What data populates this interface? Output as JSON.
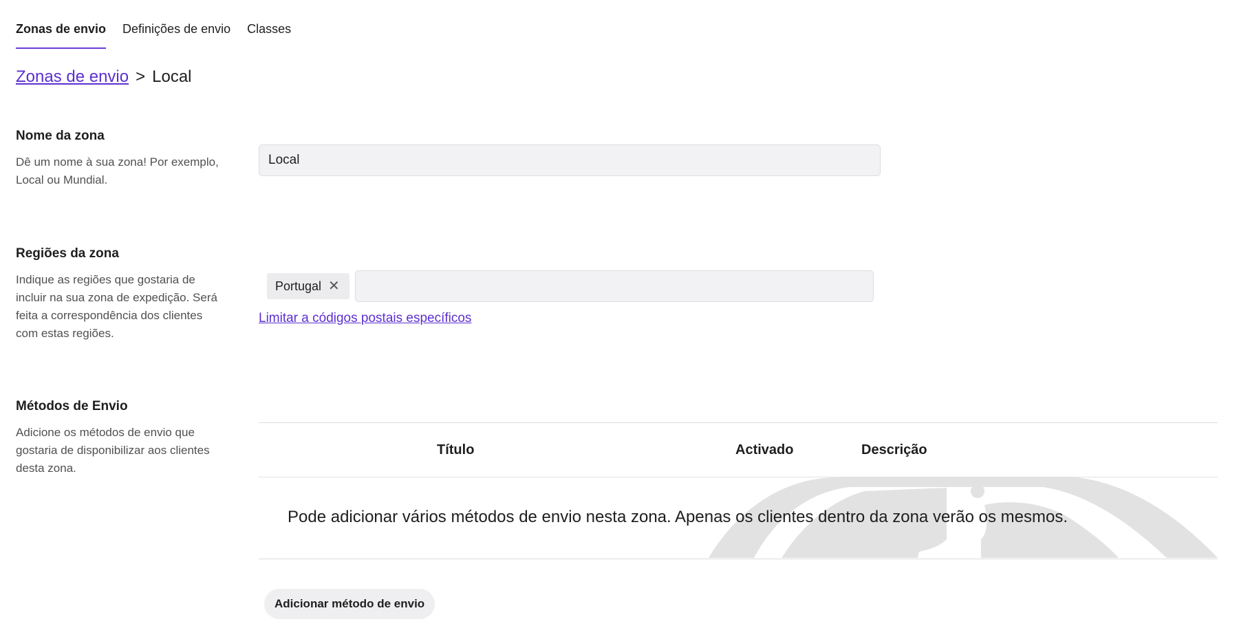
{
  "tabs": [
    {
      "label": "Zonas de envio",
      "active": true
    },
    {
      "label": "Definições de envio",
      "active": false
    },
    {
      "label": "Classes",
      "active": false
    }
  ],
  "breadcrumb": {
    "parent": "Zonas de envio",
    "separator": ">",
    "current": "Local"
  },
  "zone_name": {
    "title": "Nome da zona",
    "description": "Dê um nome à sua zona! Por exemplo, Local ou Mundial.",
    "value": "Local"
  },
  "zone_regions": {
    "title": "Regiões da zona",
    "description": "Indique as regiões que gostaria de incluir na sua zona de expedição. Será feita a correspondência dos clientes com estas regiões.",
    "chips": [
      "Portugal"
    ],
    "remove_glyph": "✕",
    "input_value": "",
    "postcode_link": "Limitar a códigos postais específicos"
  },
  "shipping_methods": {
    "title": "Métodos de Envio",
    "description": "Adicione os métodos de envio que gostaria de disponibilizar aos clientes desta zona.",
    "columns": {
      "title": "Título",
      "enabled": "Activado",
      "description": "Descrição"
    },
    "empty_message": "Pode adicionar vários métodos de envio nesta zona. Apenas os clientes dentro da zona verão os mesmos.",
    "add_button": "Adicionar método de envio"
  },
  "colors": {
    "accent": "#5b2fd0",
    "watermark": "#e2e2e2"
  }
}
